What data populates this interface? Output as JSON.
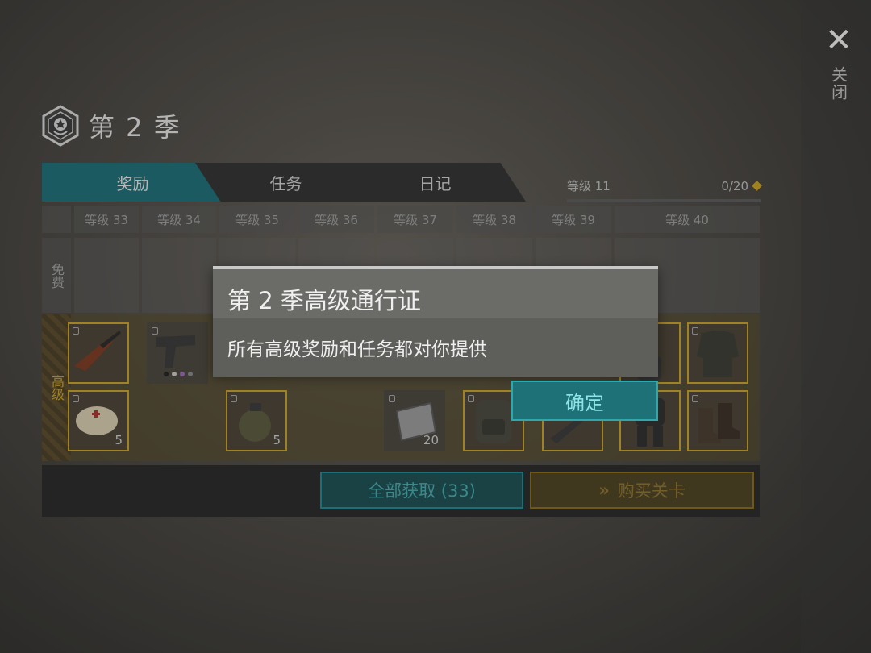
{
  "close": {
    "icon": "close-icon",
    "label": "关闭"
  },
  "season": {
    "title": "第 2 季",
    "icon": "season-badge-icon"
  },
  "tabs": [
    {
      "label": "奖励",
      "active": true
    },
    {
      "label": "任务",
      "active": false
    },
    {
      "label": "日记",
      "active": false
    }
  ],
  "level": {
    "current": "等级 11",
    "progress_text": "0/20",
    "progress_fraction": 0.0
  },
  "grid": {
    "columns": [
      "等级 33",
      "等级 34",
      "等级 35",
      "等级 36",
      "等级 37",
      "等级 38",
      "等级 39",
      "等级 40"
    ],
    "rows": {
      "free": "免费",
      "premium": "高级"
    },
    "items": [
      {
        "icon": "rifle-icon"
      },
      {
        "icon": "pistol-icon"
      },
      {
        "icon": "medkit-icon",
        "qty": "5"
      },
      {
        "icon": "grenade-icon",
        "qty": "5"
      },
      {
        "icon": "metal-plate-icon",
        "qty": "20"
      },
      {
        "icon": "backpack-icon"
      },
      {
        "icon": "weapon-icon"
      },
      {
        "icon": "armor-suit-icon"
      },
      {
        "icon": "jacket-icon"
      },
      {
        "icon": "boots-icon"
      }
    ]
  },
  "actions": {
    "claim_all": "全部获取 (33)",
    "buy": "购买关卡"
  },
  "modal": {
    "title": "第 2 季高级通行证",
    "body": "所有高级奖励和任务都对你提供",
    "confirm": "确定"
  },
  "colors": {
    "teal": "#1e6f77",
    "gold": "#c9a227"
  }
}
